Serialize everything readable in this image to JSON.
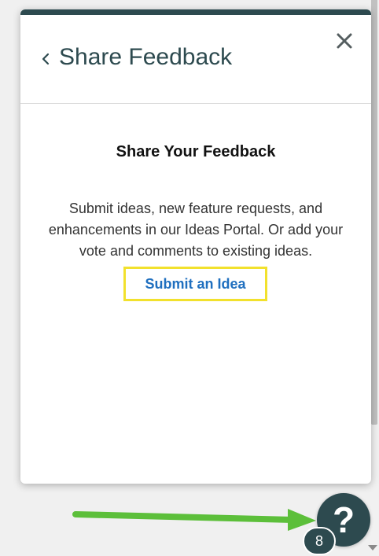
{
  "panel": {
    "title": "Share Feedback",
    "heading": "Share Your Feedback",
    "description": "Submit ideas, new feature requests, and enhancements in our Ideas Portal. Or add your vote and comments to existing ideas.",
    "submit_link_label": "Submit an Idea",
    "back_icon": "chevron-left-icon",
    "close_icon": "close-icon"
  },
  "help_button": {
    "label": "?",
    "badge_count": "8"
  },
  "colors": {
    "brand_dark": "#2d4a4f",
    "link_blue": "#1f6fbf",
    "highlight_yellow": "#f2e12d",
    "annotation_arrow_green": "#5cbf3a"
  }
}
